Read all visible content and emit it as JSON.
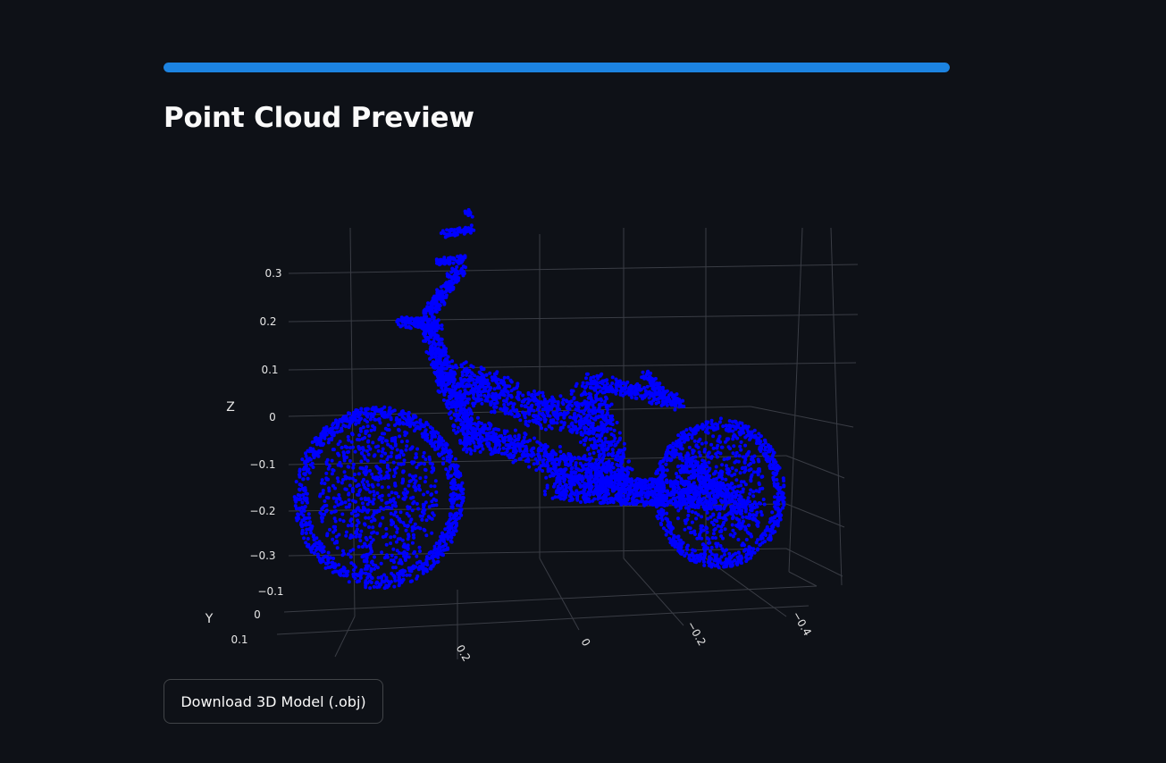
{
  "progress": {
    "value": 1.0,
    "color": "#1c83e1"
  },
  "page": {
    "title": "Point Cloud Preview"
  },
  "download": {
    "label": "Download 3D Model (.obj)"
  },
  "chart_data": {
    "type": "scatter3d",
    "marker_color": "#0000ff",
    "background": "#0e1117",
    "grid": true,
    "axes": {
      "x": {
        "title": "",
        "ticks": [
          "0.2",
          "0",
          "−0.2",
          "−0.4"
        ]
      },
      "y": {
        "title": "Y",
        "ticks": [
          "0.1",
          "0",
          "−0.1"
        ]
      },
      "z": {
        "title": "Z",
        "ticks": [
          "0.3",
          "0.2",
          "0.1",
          "0",
          "−0.1",
          "−0.2",
          "−0.3"
        ]
      }
    },
    "object": "bicycle point cloud"
  }
}
